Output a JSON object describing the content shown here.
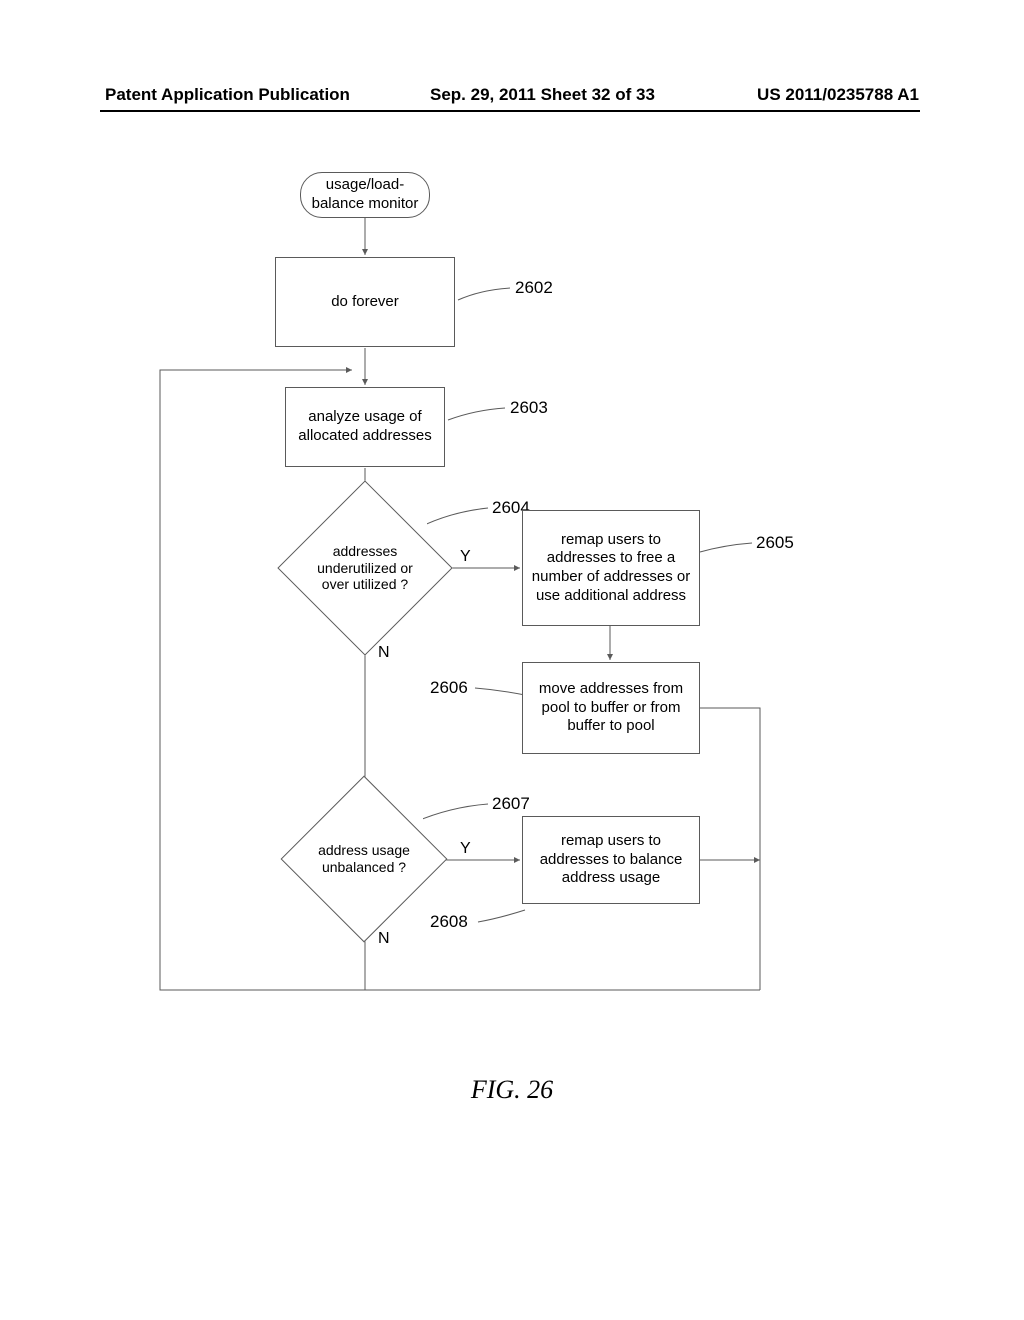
{
  "header": {
    "left": "Patent Application Publication",
    "center": "Sep. 29, 2011  Sheet 32 of 33",
    "right": "US 2011/0235788 A1"
  },
  "nodes": {
    "start": "usage/load-balance monitor",
    "n2602": "do forever",
    "n2603": "analyze usage of allocated addresses",
    "d2604": "addresses underutilized or over utilized ?",
    "n2605": "remap users to addresses to free a number of addresses or use additional address",
    "n2606": "move addresses from pool to buffer or from buffer to pool",
    "d2607": "address usage unbalanced ?",
    "n2608": "remap users to addresses to balance address usage"
  },
  "edge_labels": {
    "y1": "Y",
    "n1": "N",
    "y2": "Y",
    "n2": "N"
  },
  "refs": {
    "r2602": "2602",
    "r2603": "2603",
    "r2604": "2604",
    "r2605": "2605",
    "r2606": "2606",
    "r2607": "2607",
    "r2608": "2608"
  },
  "figure_caption": "FIG. 26"
}
